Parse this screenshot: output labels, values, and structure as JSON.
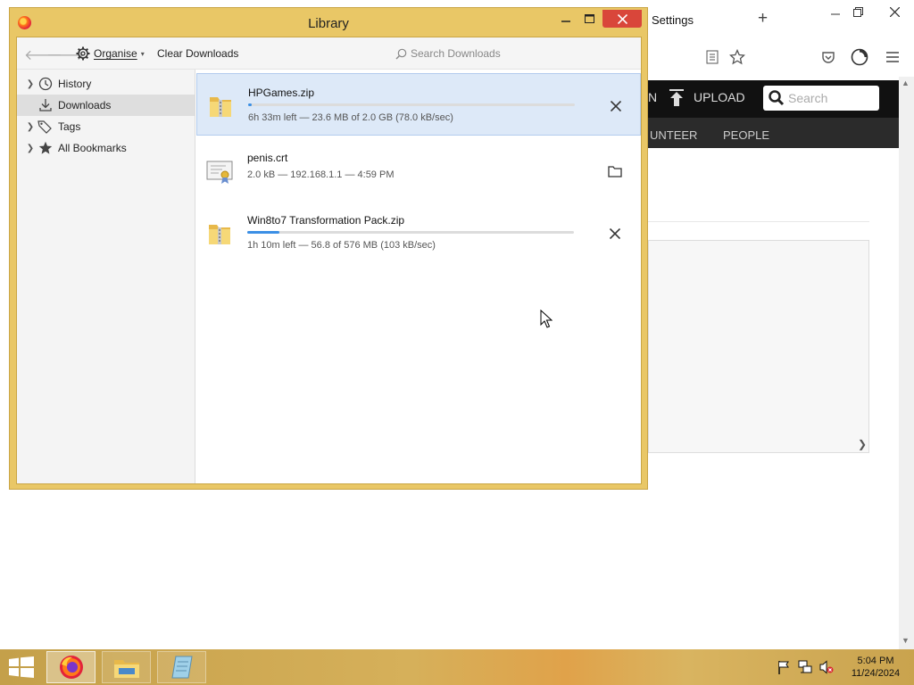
{
  "background_browser": {
    "tab_title": "Settings",
    "new_tab_symbol": "+",
    "site": {
      "partial_nav_text": "N",
      "upload_label": "UPLOAD",
      "search_placeholder": "Search",
      "nav_partial": "UNTEER",
      "nav_people": "PEOPLE"
    }
  },
  "library": {
    "title": "Library",
    "toolbar": {
      "organise_label": "Organise",
      "clear_downloads_label": "Clear Downloads",
      "search_placeholder": "Search Downloads"
    },
    "sidebar": {
      "items": [
        {
          "label": "History",
          "icon": "clock-icon",
          "expandable": true
        },
        {
          "label": "Downloads",
          "icon": "download-icon",
          "expandable": false,
          "selected": true
        },
        {
          "label": "Tags",
          "icon": "tag-icon",
          "expandable": true
        },
        {
          "label": "All Bookmarks",
          "icon": "star-icon",
          "expandable": true
        }
      ]
    },
    "downloads": [
      {
        "name": "HPGames.zip",
        "status": "6h 33m left — 23.6 MB of 2.0 GB (78.0 kB/sec)",
        "progress_percent": 1.2,
        "in_progress": true,
        "action_icon": "cancel-icon",
        "file_icon": "zip-folder-icon"
      },
      {
        "name": "penis.crt",
        "status": "2.0 kB — 192.168.1.1 — 4:59 PM",
        "in_progress": false,
        "action_icon": "open-folder-icon",
        "file_icon": "certificate-icon"
      },
      {
        "name": "Win8to7 Transformation Pack.zip",
        "status": "1h 10m left — 56.8 of 576 MB (103 kB/sec)",
        "progress_percent": 9.9,
        "in_progress": true,
        "action_icon": "cancel-icon",
        "file_icon": "zip-folder-icon"
      }
    ]
  },
  "taskbar": {
    "clock_time": "5:04 PM",
    "clock_date": "11/24/2024",
    "apps": [
      "firefox-icon",
      "file-explorer-icon",
      "notepad-icon"
    ]
  },
  "colors": {
    "window_frame": "#e9c766",
    "close_button": "#d9463a",
    "selection": "#dde9f8",
    "progress": "#3b8fe5"
  }
}
